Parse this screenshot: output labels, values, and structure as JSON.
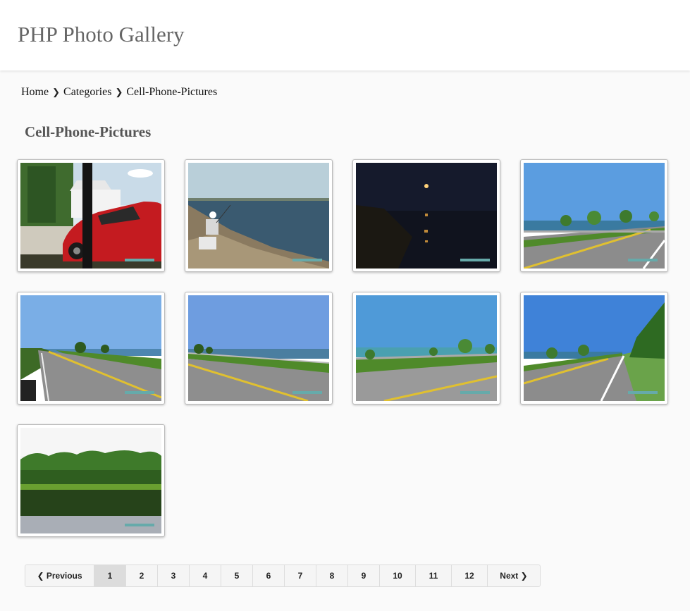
{
  "header": {
    "site_title": "PHP Photo Gallery"
  },
  "breadcrumb": {
    "items": [
      "Home",
      "Categories",
      "Cell-Phone-Pictures"
    ],
    "separator": "❯"
  },
  "page_title": "Cell-Phone-Pictures",
  "gallery": {
    "photos": [
      {
        "scene": "red-car-house"
      },
      {
        "scene": "fisherman-lake"
      },
      {
        "scene": "moon-night-lake"
      },
      {
        "scene": "lakeside-road"
      },
      {
        "scene": "lakeside-road"
      },
      {
        "scene": "lakeside-road"
      },
      {
        "scene": "lakeside-road"
      },
      {
        "scene": "lakeside-road"
      },
      {
        "scene": "forest-reflection"
      }
    ]
  },
  "pagination": {
    "previous_label": "❮ Previous",
    "pages": [
      "1",
      "2",
      "3",
      "4",
      "5",
      "6",
      "7",
      "8",
      "9",
      "10",
      "11",
      "12"
    ],
    "current_page": "1",
    "next_label": "Next ❯"
  }
}
